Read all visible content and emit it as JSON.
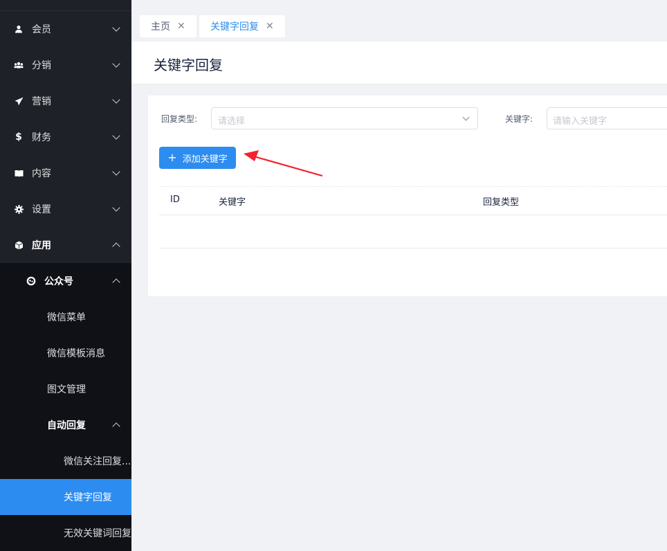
{
  "sidebar": {
    "items": [
      {
        "label": "会员",
        "icon": "user-icon"
      },
      {
        "label": "分销",
        "icon": "group-icon"
      },
      {
        "label": "营销",
        "icon": "send-icon"
      },
      {
        "label": "财务",
        "icon": "dollar-icon"
      },
      {
        "label": "内容",
        "icon": "book-icon"
      },
      {
        "label": "设置",
        "icon": "gear-icon"
      },
      {
        "label": "应用",
        "icon": "cube-icon"
      }
    ],
    "sub": {
      "label": "公众号",
      "icon": "wechat-icon",
      "children": [
        "微信菜单",
        "微信模板消息",
        "图文管理",
        "自动回复"
      ],
      "auto_reply_children": [
        "微信关注回复...",
        "关键字回复",
        "无效关键词回复"
      ]
    }
  },
  "tabs": [
    {
      "label": "主页"
    },
    {
      "label": "关键字回复"
    }
  ],
  "page": {
    "title": "关键字回复"
  },
  "filters": {
    "reply_type_label": "回复类型:",
    "reply_type_placeholder": "请选择",
    "keyword_label": "关键字:",
    "keyword_placeholder": "请输入关键字"
  },
  "toolbar": {
    "add_label": "添加关键字"
  },
  "table": {
    "columns": [
      "ID",
      "关键字",
      "回复类型"
    ]
  },
  "colors": {
    "accent": "#2d8cf0",
    "sidebar": "#1f2129",
    "annotation": "#f5222d"
  }
}
